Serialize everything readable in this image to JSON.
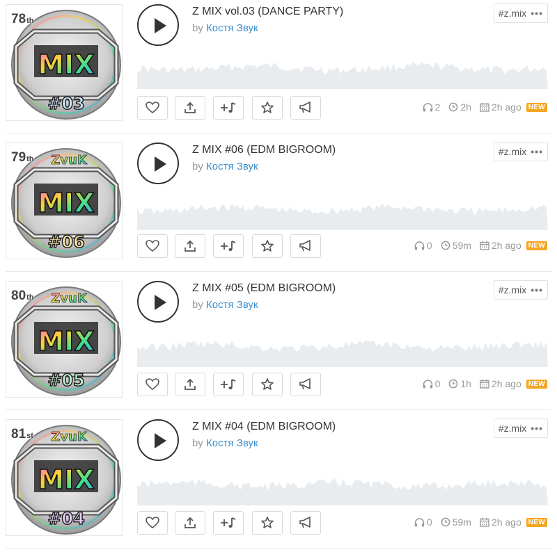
{
  "colors": {
    "accent": "#3b8fd0",
    "badge": "#f5a623",
    "waveform": "#e9ecef"
  },
  "tracks": [
    {
      "rank": "78",
      "rank_suffix": "th",
      "title": "Z MIX vol.03 (DANCE PARTY)",
      "by_label": "by",
      "artist": "Костя Звук",
      "tag": "#z.mix",
      "more": "•••",
      "plays": "2",
      "duration": "2h",
      "uploaded": "2h ago",
      "badge": "NEW",
      "art_number": "#03",
      "art_top": ""
    },
    {
      "rank": "79",
      "rank_suffix": "th",
      "title": "Z MIX #06 (EDM BIGROOM)",
      "by_label": "by",
      "artist": "Костя Звук",
      "tag": "#z.mix",
      "more": "•••",
      "plays": "0",
      "duration": "59m",
      "uploaded": "2h ago",
      "badge": "NEW",
      "art_number": "#06",
      "art_top": "ZvuK"
    },
    {
      "rank": "80",
      "rank_suffix": "th",
      "title": "Z MIX #05 (EDM BIGROOM)",
      "by_label": "by",
      "artist": "Костя Звук",
      "tag": "#z.mix",
      "more": "•••",
      "plays": "0",
      "duration": "1h",
      "uploaded": "2h ago",
      "badge": "NEW",
      "art_number": "#05",
      "art_top": "ZvuK"
    },
    {
      "rank": "81",
      "rank_suffix": "st",
      "title": "Z MIX #04 (EDM BIGROOM)",
      "by_label": "by",
      "artist": "Костя Звук",
      "tag": "#z.mix",
      "more": "•••",
      "plays": "0",
      "duration": "59m",
      "uploaded": "2h ago",
      "badge": "NEW",
      "art_number": "#04",
      "art_top": "ZvuK"
    }
  ],
  "art_logo": "MIX",
  "icons": {
    "like": "heart-icon",
    "repost": "share-upload-icon",
    "add": "add-to-playlist-icon",
    "favorite": "star-icon",
    "promote": "megaphone-icon",
    "plays": "headphones-icon",
    "duration": "clock-icon",
    "date": "calendar-icon",
    "play": "play-icon"
  }
}
